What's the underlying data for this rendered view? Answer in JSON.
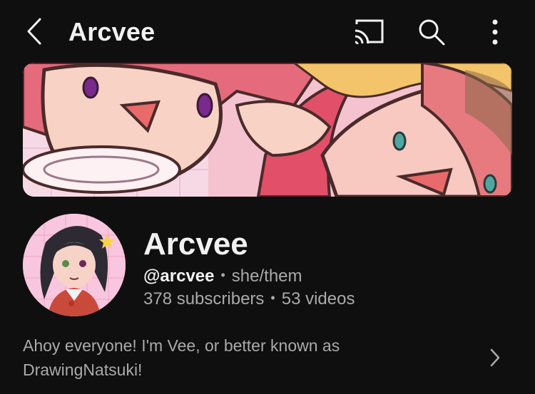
{
  "header": {
    "title": "Arcvee",
    "icons": {
      "back": "back-arrow-icon",
      "cast": "cast-icon",
      "search": "search-icon",
      "more": "more-vertical-icon"
    }
  },
  "banner": {
    "description": "anime-art-banner"
  },
  "channel": {
    "avatar": "channel-avatar",
    "name": "Arcvee",
    "handle": "@arcvee",
    "separator": "•",
    "pronouns": "she/them",
    "subscribers": "378 subscribers",
    "videos": "53 videos",
    "description_line1": "Ahoy everyone! I'm Vee, or better known as",
    "description_line2": "DrawingNatsuki!",
    "expand_icon": "chevron-right-icon"
  },
  "colors": {
    "background": "#0f0f0f",
    "text": "#f1f1f1",
    "secondary_text": "#aaaaaa"
  }
}
